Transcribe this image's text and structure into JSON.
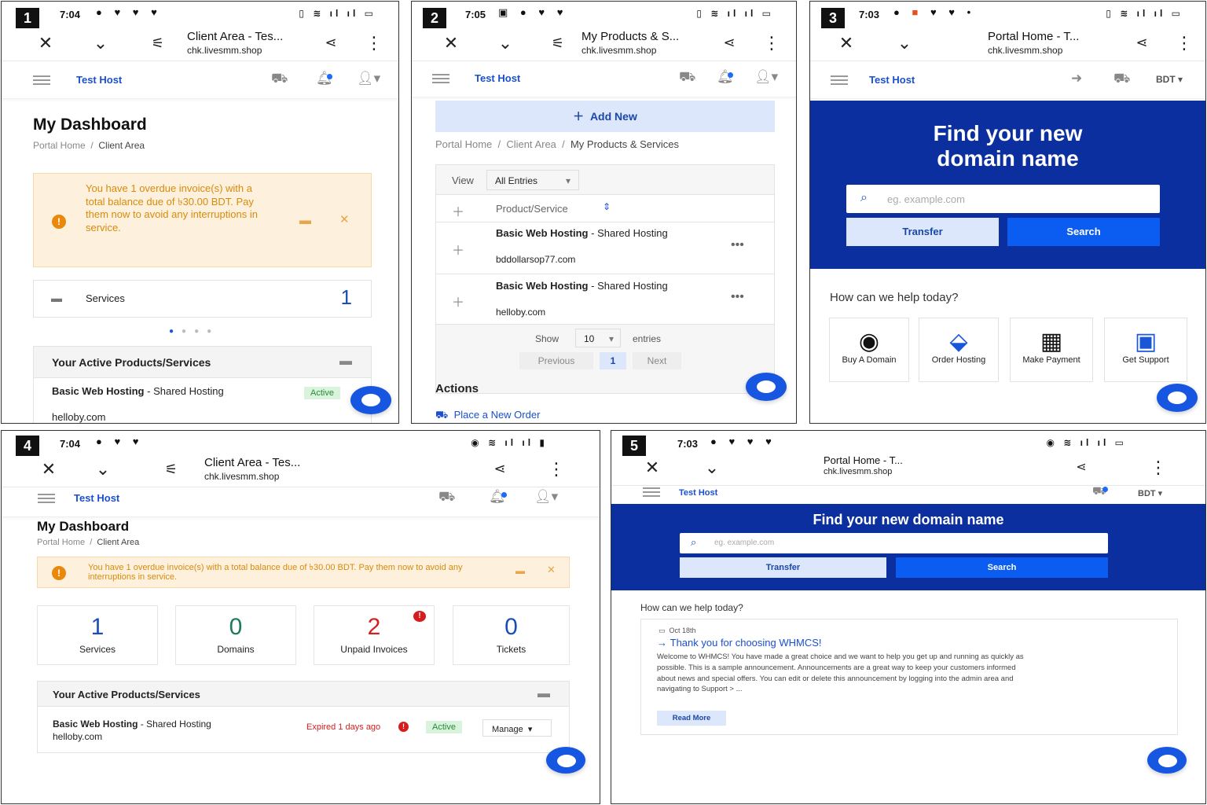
{
  "p1": {
    "num": "1",
    "time": "7:04",
    "title": "Client Area - Tes...",
    "url": "chk.livesmm.shop",
    "brand": "Test Host",
    "heading": "My Dashboard",
    "crumb1": "Portal Home",
    "crumb2": "Client Area",
    "alert": "You have 1 overdue invoice(s) with a total balance due of ৳30.00 BDT. Pay them now to avoid any interruptions in service.",
    "services_label": "Services",
    "services_count": "1",
    "section": "Your Active Products/Services",
    "product_bold": "Basic Web Hosting",
    "product_rest": " - Shared Hosting",
    "domain": "helloby.com",
    "status": "Active"
  },
  "p2": {
    "num": "2",
    "time": "7:05",
    "title": "My Products & S...",
    "url": "chk.livesmm.shop",
    "brand": "Test Host",
    "add_new": "Add New",
    "crumb1": "Portal Home",
    "crumb2": "Client Area",
    "crumb3": "My Products & Services",
    "view_label": "View",
    "view_value": "All Entries",
    "col_header": "Product/Service",
    "rows": [
      {
        "bold": "Basic Web Hosting",
        "rest": " - Shared Hosting",
        "domain": "bddollarsop77.com"
      },
      {
        "bold": "Basic Web Hosting",
        "rest": " - Shared Hosting",
        "domain": "helloby.com"
      }
    ],
    "show": "Show",
    "show_value": "10",
    "entries": "entries",
    "prev": "Previous",
    "page": "1",
    "next": "Next",
    "actions": "Actions",
    "place_order": "Place a New Order"
  },
  "p3": {
    "num": "3",
    "time": "7:03",
    "title": "Portal Home - T...",
    "url": "chk.livesmm.shop",
    "brand": "Test Host",
    "currency": "BDT",
    "hero": "Find your new domain name",
    "placeholder": "eg. example.com",
    "transfer": "Transfer",
    "search": "Search",
    "help": "How can we help today?",
    "tiles": [
      "Buy A Domain",
      "Order Hosting",
      "Make Payment",
      "Get Support"
    ]
  },
  "p4": {
    "num": "4",
    "time": "7:04",
    "title": "Client Area - Tes...",
    "url": "chk.livesmm.shop",
    "brand": "Test Host",
    "heading": "My Dashboard",
    "crumb1": "Portal Home",
    "crumb2": "Client Area",
    "alert": "You have 1 overdue invoice(s) with a total balance due of ৳30.00 BDT. Pay them now to avoid any interruptions in service.",
    "stats": [
      {
        "n": "1",
        "l": "Services",
        "c": "#1a4fb8"
      },
      {
        "n": "0",
        "l": "Domains",
        "c": "#1e7a5a"
      },
      {
        "n": "2",
        "l": "Unpaid Invoices",
        "c": "#d32020"
      },
      {
        "n": "0",
        "l": "Tickets",
        "c": "#1a4fb8"
      }
    ],
    "section": "Your Active Products/Services",
    "product_bold": "Basic Web Hosting",
    "product_rest": " - Shared Hosting",
    "domain": "helloby.com",
    "expired": "Expired 1 days ago",
    "status": "Active",
    "manage": "Manage"
  },
  "p5": {
    "num": "5",
    "time": "7:03",
    "title": "Portal Home - T...",
    "url": "chk.livesmm.shop",
    "brand": "Test Host",
    "currency": "BDT",
    "hero": "Find your new domain name",
    "placeholder": "eg. example.com",
    "transfer": "Transfer",
    "search": "Search",
    "help": "How can we help today?",
    "date": "Oct 18th",
    "ann_title": "Thank you for choosing WHMCS!",
    "ann_body": "Welcome to WHMCS! You have made a great choice and we want to help you get up and running as quickly as possible. This is a sample announcement. Announcements are a great way to keep your customers informed about news and special offers. You can edit or delete this announcement by logging into the admin area and navigating to Support > ...",
    "read_more": "Read More"
  }
}
